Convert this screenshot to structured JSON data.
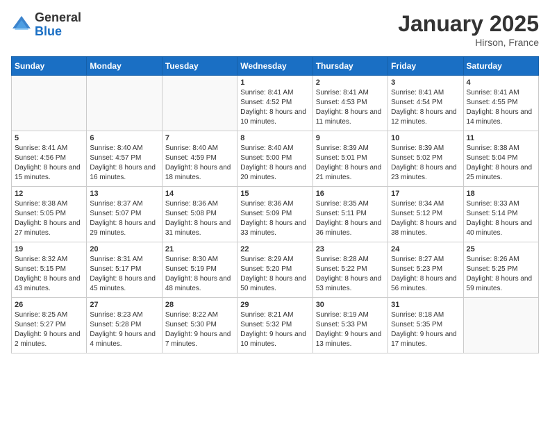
{
  "header": {
    "logo_general": "General",
    "logo_blue": "Blue",
    "month_title": "January 2025",
    "location": "Hirson, France"
  },
  "weekdays": [
    "Sunday",
    "Monday",
    "Tuesday",
    "Wednesday",
    "Thursday",
    "Friday",
    "Saturday"
  ],
  "weeks": [
    [
      {
        "day": "",
        "sunrise": "",
        "sunset": "",
        "daylight": ""
      },
      {
        "day": "",
        "sunrise": "",
        "sunset": "",
        "daylight": ""
      },
      {
        "day": "",
        "sunrise": "",
        "sunset": "",
        "daylight": ""
      },
      {
        "day": "1",
        "sunrise": "Sunrise: 8:41 AM",
        "sunset": "Sunset: 4:52 PM",
        "daylight": "Daylight: 8 hours and 10 minutes."
      },
      {
        "day": "2",
        "sunrise": "Sunrise: 8:41 AM",
        "sunset": "Sunset: 4:53 PM",
        "daylight": "Daylight: 8 hours and 11 minutes."
      },
      {
        "day": "3",
        "sunrise": "Sunrise: 8:41 AM",
        "sunset": "Sunset: 4:54 PM",
        "daylight": "Daylight: 8 hours and 12 minutes."
      },
      {
        "day": "4",
        "sunrise": "Sunrise: 8:41 AM",
        "sunset": "Sunset: 4:55 PM",
        "daylight": "Daylight: 8 hours and 14 minutes."
      }
    ],
    [
      {
        "day": "5",
        "sunrise": "Sunrise: 8:41 AM",
        "sunset": "Sunset: 4:56 PM",
        "daylight": "Daylight: 8 hours and 15 minutes."
      },
      {
        "day": "6",
        "sunrise": "Sunrise: 8:40 AM",
        "sunset": "Sunset: 4:57 PM",
        "daylight": "Daylight: 8 hours and 16 minutes."
      },
      {
        "day": "7",
        "sunrise": "Sunrise: 8:40 AM",
        "sunset": "Sunset: 4:59 PM",
        "daylight": "Daylight: 8 hours and 18 minutes."
      },
      {
        "day": "8",
        "sunrise": "Sunrise: 8:40 AM",
        "sunset": "Sunset: 5:00 PM",
        "daylight": "Daylight: 8 hours and 20 minutes."
      },
      {
        "day": "9",
        "sunrise": "Sunrise: 8:39 AM",
        "sunset": "Sunset: 5:01 PM",
        "daylight": "Daylight: 8 hours and 21 minutes."
      },
      {
        "day": "10",
        "sunrise": "Sunrise: 8:39 AM",
        "sunset": "Sunset: 5:02 PM",
        "daylight": "Daylight: 8 hours and 23 minutes."
      },
      {
        "day": "11",
        "sunrise": "Sunrise: 8:38 AM",
        "sunset": "Sunset: 5:04 PM",
        "daylight": "Daylight: 8 hours and 25 minutes."
      }
    ],
    [
      {
        "day": "12",
        "sunrise": "Sunrise: 8:38 AM",
        "sunset": "Sunset: 5:05 PM",
        "daylight": "Daylight: 8 hours and 27 minutes."
      },
      {
        "day": "13",
        "sunrise": "Sunrise: 8:37 AM",
        "sunset": "Sunset: 5:07 PM",
        "daylight": "Daylight: 8 hours and 29 minutes."
      },
      {
        "day": "14",
        "sunrise": "Sunrise: 8:36 AM",
        "sunset": "Sunset: 5:08 PM",
        "daylight": "Daylight: 8 hours and 31 minutes."
      },
      {
        "day": "15",
        "sunrise": "Sunrise: 8:36 AM",
        "sunset": "Sunset: 5:09 PM",
        "daylight": "Daylight: 8 hours and 33 minutes."
      },
      {
        "day": "16",
        "sunrise": "Sunrise: 8:35 AM",
        "sunset": "Sunset: 5:11 PM",
        "daylight": "Daylight: 8 hours and 36 minutes."
      },
      {
        "day": "17",
        "sunrise": "Sunrise: 8:34 AM",
        "sunset": "Sunset: 5:12 PM",
        "daylight": "Daylight: 8 hours and 38 minutes."
      },
      {
        "day": "18",
        "sunrise": "Sunrise: 8:33 AM",
        "sunset": "Sunset: 5:14 PM",
        "daylight": "Daylight: 8 hours and 40 minutes."
      }
    ],
    [
      {
        "day": "19",
        "sunrise": "Sunrise: 8:32 AM",
        "sunset": "Sunset: 5:15 PM",
        "daylight": "Daylight: 8 hours and 43 minutes."
      },
      {
        "day": "20",
        "sunrise": "Sunrise: 8:31 AM",
        "sunset": "Sunset: 5:17 PM",
        "daylight": "Daylight: 8 hours and 45 minutes."
      },
      {
        "day": "21",
        "sunrise": "Sunrise: 8:30 AM",
        "sunset": "Sunset: 5:19 PM",
        "daylight": "Daylight: 8 hours and 48 minutes."
      },
      {
        "day": "22",
        "sunrise": "Sunrise: 8:29 AM",
        "sunset": "Sunset: 5:20 PM",
        "daylight": "Daylight: 8 hours and 50 minutes."
      },
      {
        "day": "23",
        "sunrise": "Sunrise: 8:28 AM",
        "sunset": "Sunset: 5:22 PM",
        "daylight": "Daylight: 8 hours and 53 minutes."
      },
      {
        "day": "24",
        "sunrise": "Sunrise: 8:27 AM",
        "sunset": "Sunset: 5:23 PM",
        "daylight": "Daylight: 8 hours and 56 minutes."
      },
      {
        "day": "25",
        "sunrise": "Sunrise: 8:26 AM",
        "sunset": "Sunset: 5:25 PM",
        "daylight": "Daylight: 8 hours and 59 minutes."
      }
    ],
    [
      {
        "day": "26",
        "sunrise": "Sunrise: 8:25 AM",
        "sunset": "Sunset: 5:27 PM",
        "daylight": "Daylight: 9 hours and 2 minutes."
      },
      {
        "day": "27",
        "sunrise": "Sunrise: 8:23 AM",
        "sunset": "Sunset: 5:28 PM",
        "daylight": "Daylight: 9 hours and 4 minutes."
      },
      {
        "day": "28",
        "sunrise": "Sunrise: 8:22 AM",
        "sunset": "Sunset: 5:30 PM",
        "daylight": "Daylight: 9 hours and 7 minutes."
      },
      {
        "day": "29",
        "sunrise": "Sunrise: 8:21 AM",
        "sunset": "Sunset: 5:32 PM",
        "daylight": "Daylight: 9 hours and 10 minutes."
      },
      {
        "day": "30",
        "sunrise": "Sunrise: 8:19 AM",
        "sunset": "Sunset: 5:33 PM",
        "daylight": "Daylight: 9 hours and 13 minutes."
      },
      {
        "day": "31",
        "sunrise": "Sunrise: 8:18 AM",
        "sunset": "Sunset: 5:35 PM",
        "daylight": "Daylight: 9 hours and 17 minutes."
      },
      {
        "day": "",
        "sunrise": "",
        "sunset": "",
        "daylight": ""
      }
    ]
  ]
}
